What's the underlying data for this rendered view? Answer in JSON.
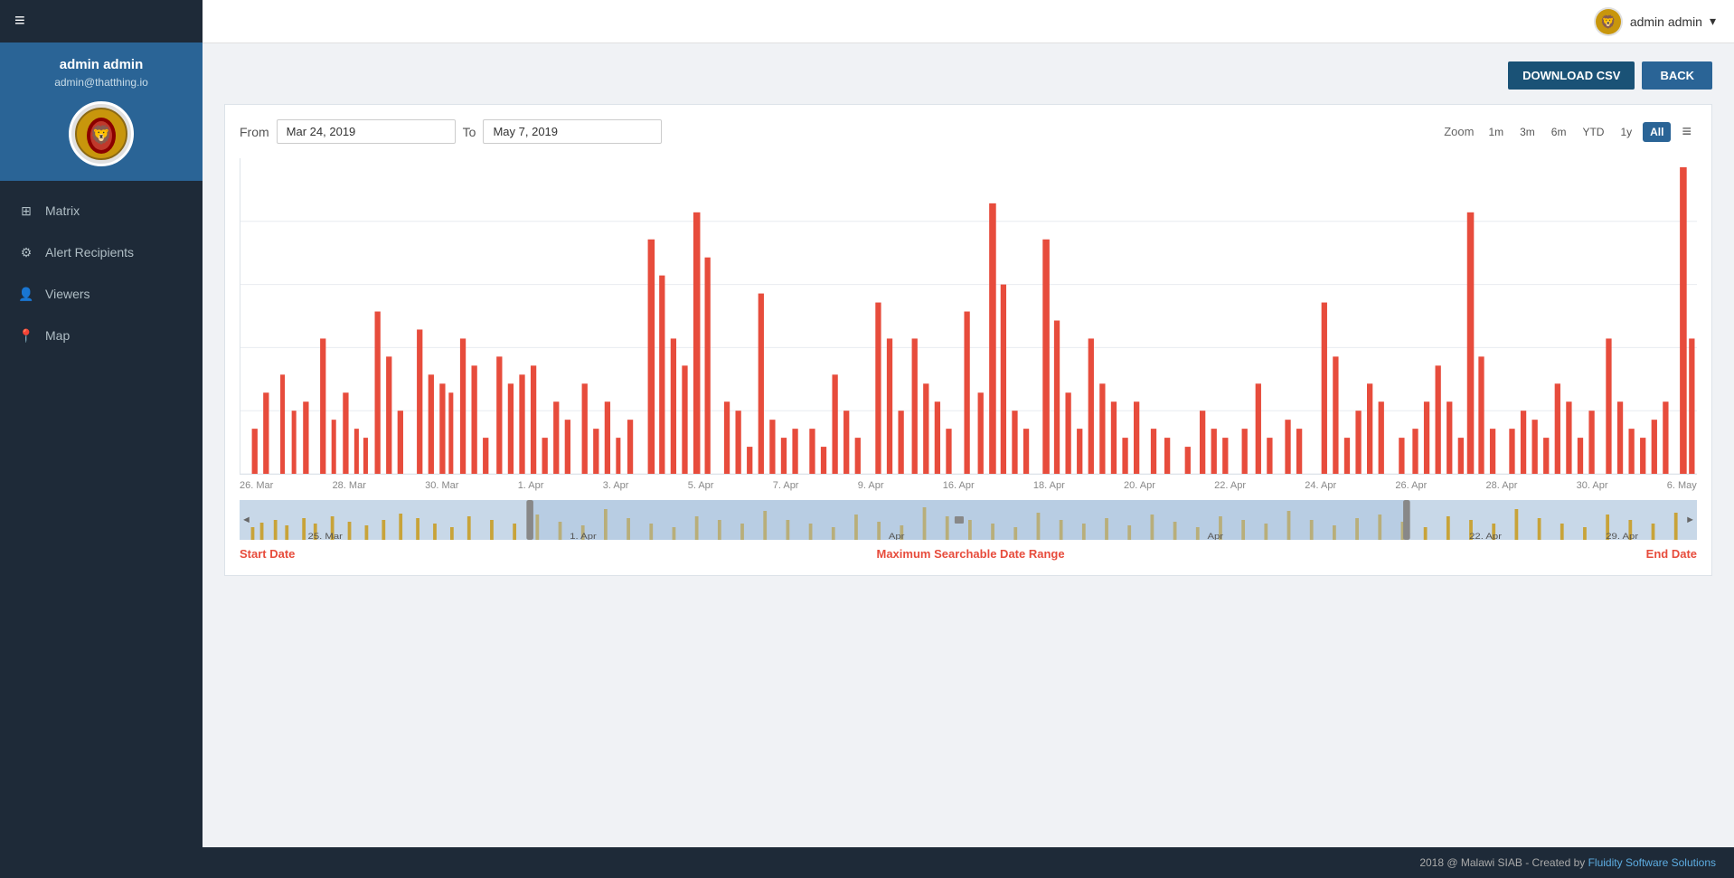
{
  "sidebar": {
    "hamburger_label": "≡",
    "admin_name": "admin admin",
    "admin_email": "admin@thatthing.io",
    "nav_items": [
      {
        "id": "matrix",
        "label": "Matrix",
        "icon": "⊞"
      },
      {
        "id": "alert-recipients",
        "label": "Alert Recipients",
        "icon": "⚙"
      },
      {
        "id": "viewers",
        "label": "Viewers",
        "icon": "👤"
      },
      {
        "id": "map",
        "label": "Map",
        "icon": "📍"
      }
    ]
  },
  "topbar": {
    "user_name": "admin admin",
    "dropdown_icon": "▾"
  },
  "toolbar": {
    "download_csv_label": "DOWNLOAD CSV",
    "back_label": "BACK"
  },
  "chart": {
    "from_label": "From",
    "to_label": "To",
    "from_date": "Mar 24, 2019",
    "to_date": "May 7, 2019",
    "zoom_label": "Zoom",
    "zoom_options": [
      "1m",
      "3m",
      "6m",
      "YTD",
      "1y",
      "All"
    ],
    "active_zoom": "All",
    "xaxis_labels": [
      "26. Mar",
      "28. Mar",
      "30. Mar",
      "1. Apr",
      "3. Apr",
      "5. Apr",
      "7. Apr",
      "9. Apr",
      "16. Apr",
      "18. Apr",
      "20. Apr",
      "22. Apr",
      "24. Apr",
      "26. Apr",
      "28. Apr",
      "30. Apr",
      "6. May"
    ],
    "bar_color": "#e74c3c",
    "mini_bar_color": "#c8960c"
  },
  "range_labels": {
    "start": "Start Date",
    "middle": "Maximum Searchable Date Range",
    "end": "End Date"
  },
  "footer": {
    "text": "2018 @ Malawi SIAB - Created by ",
    "link_text": "Fluidity Software Solutions",
    "link_url": "#"
  }
}
